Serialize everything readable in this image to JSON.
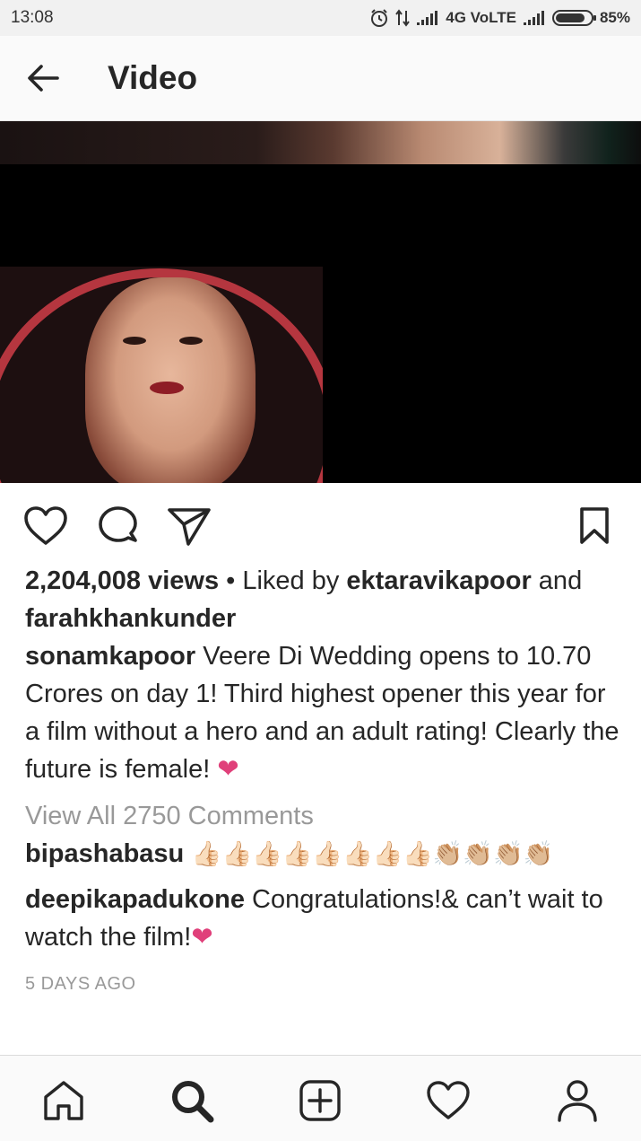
{
  "status_bar": {
    "time": "13:08",
    "network": "4G VoLTE",
    "battery": "85%",
    "battery_level": 0.85
  },
  "header": {
    "title": "Video",
    "back_icon": "arrow-left-icon"
  },
  "post": {
    "views": "2,204,008 views",
    "separator": " • Liked by ",
    "liked_by_1": "ektaravikapoor",
    "and": " and",
    "liked_by_2": "farahkhankunder",
    "caption_user": "sonamkapoor",
    "caption_text": " Veere Di Wedding opens to 10.70 Crores on day 1! Third highest opener this year for a film without a hero and an adult rating! Clearly the future is female! ",
    "caption_emoji": "❤",
    "view_all_comments": "View All 2750 Comments",
    "comments": [
      {
        "user": "bipashabasu",
        "text": " 👍🏻👍🏻👍🏻👍🏻👍🏻👍🏻👍🏻👍🏻👏🏼👏🏼👏🏼👏🏼"
      },
      {
        "user": "deepikapadukone",
        "text": " Congratulations!& can’t wait to watch the film!",
        "emoji": "❤"
      }
    ],
    "time_ago": "5 DAYS AGO"
  },
  "actions": [
    "heart-icon",
    "comment-icon",
    "share-icon",
    "bookmark-icon"
  ],
  "bottom_nav": [
    "home-icon",
    "search-icon",
    "add-icon",
    "activity-heart-icon",
    "profile-icon"
  ]
}
